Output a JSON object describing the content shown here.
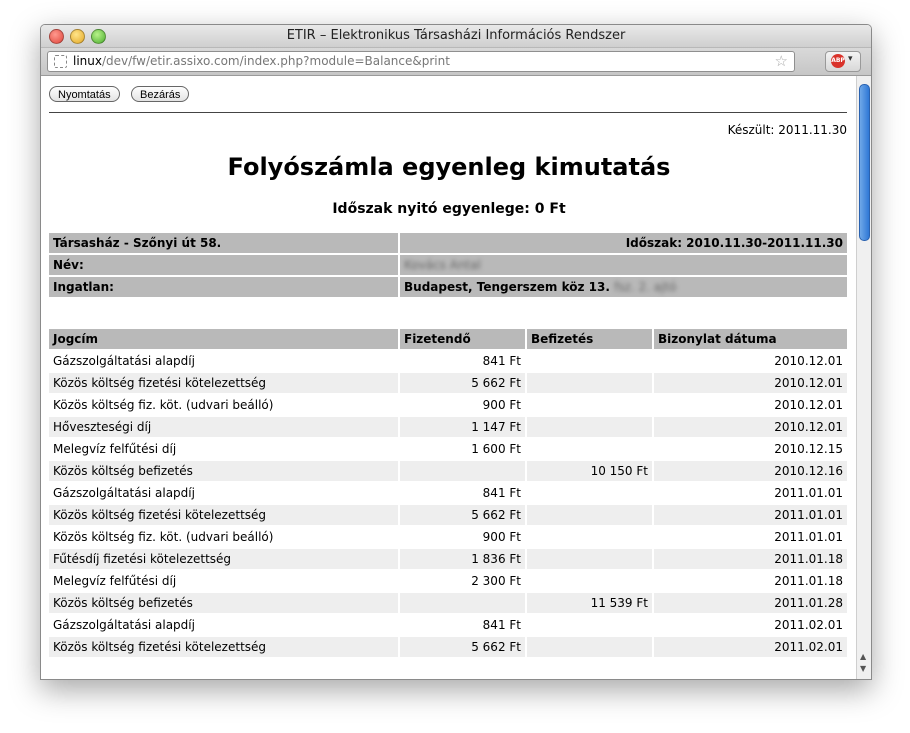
{
  "window": {
    "title": "ETIR – Elektronikus Társasházi Információs Rendszer"
  },
  "url": {
    "host": "linux",
    "path": "/dev/fw/etir.assixo.com/index.php?module=Balance&print"
  },
  "buttons": {
    "print": "Nyomtatás",
    "close": "Bezárás"
  },
  "created": "Készült: 2011.11.30",
  "title": "Folyószámla egyenleg kimutatás",
  "subtitle": "Időszak nyitó egyenlege: 0 Ft",
  "info": {
    "house": "Társasház - Szőnyi út 58.",
    "period": "Időszak: 2010.11.30-2011.11.30",
    "name_label": "Név:",
    "name_value": "Kovács Antal",
    "property_label": "Ingatlan:",
    "property_value": "Budapest, Tengerszem köz 13.",
    "property_hidden": "fsz. 2. ajtó"
  },
  "table": {
    "headers": [
      "Jogcím",
      "Fizetendő",
      "Befizetés",
      "Bizonylat dátuma"
    ],
    "rows": [
      {
        "title": "Gázszolgáltatási alapdíj",
        "due": "841 Ft",
        "paid": "",
        "date": "2010.12.01"
      },
      {
        "title": "Közös költség fizetési kötelezettség",
        "due": "5 662 Ft",
        "paid": "",
        "date": "2010.12.01"
      },
      {
        "title": "Közös költség fiz. köt. (udvari beálló)",
        "due": "900 Ft",
        "paid": "",
        "date": "2010.12.01"
      },
      {
        "title": "Hőveszteségi díj",
        "due": "1 147 Ft",
        "paid": "",
        "date": "2010.12.01"
      },
      {
        "title": "Melegvíz felfűtési díj",
        "due": "1 600 Ft",
        "paid": "",
        "date": "2010.12.15"
      },
      {
        "title": "Közös költség befizetés",
        "due": "",
        "paid": "10 150 Ft",
        "date": "2010.12.16"
      },
      {
        "title": "Gázszolgáltatási alapdíj",
        "due": "841 Ft",
        "paid": "",
        "date": "2011.01.01"
      },
      {
        "title": "Közös költség fizetési kötelezettség",
        "due": "5 662 Ft",
        "paid": "",
        "date": "2011.01.01"
      },
      {
        "title": "Közös költség fiz. köt. (udvari beálló)",
        "due": "900 Ft",
        "paid": "",
        "date": "2011.01.01"
      },
      {
        "title": "Fűtésdíj fizetési kötelezettség",
        "due": "1 836 Ft",
        "paid": "",
        "date": "2011.01.18"
      },
      {
        "title": "Melegvíz felfűtési díj",
        "due": "2 300 Ft",
        "paid": "",
        "date": "2011.01.18"
      },
      {
        "title": "Közös költség befizetés",
        "due": "",
        "paid": "11 539 Ft",
        "date": "2011.01.28"
      },
      {
        "title": "Gázszolgáltatási alapdíj",
        "due": "841 Ft",
        "paid": "",
        "date": "2011.02.01"
      },
      {
        "title": "Közös költség fizetési kötelezettség",
        "due": "5 662 Ft",
        "paid": "",
        "date": "2011.02.01"
      }
    ]
  }
}
